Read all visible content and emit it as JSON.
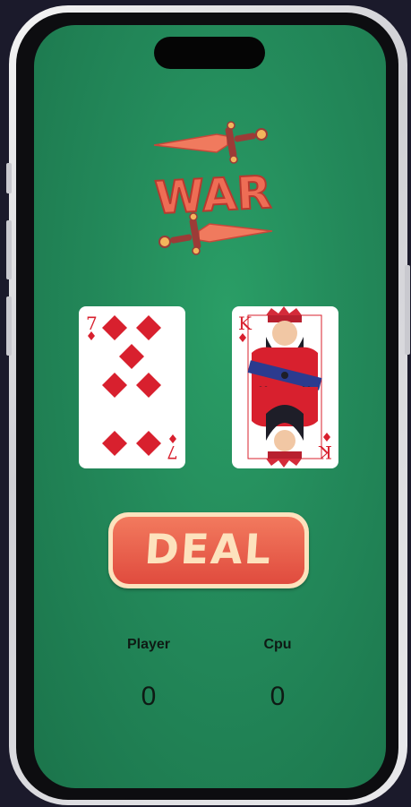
{
  "logo": {
    "text": "WAR"
  },
  "cards": {
    "player": {
      "rank": "7",
      "suit": "diamonds"
    },
    "cpu": {
      "rank": "K",
      "suit": "diamonds"
    }
  },
  "deal_button": {
    "label": "DEAL"
  },
  "scores": {
    "player_label": "Player",
    "cpu_label": "Cpu",
    "player_score": "0",
    "cpu_score": "0"
  },
  "colors": {
    "table_green": "#23895a",
    "accent_red": "#e04b3e",
    "cream": "#fde2bd",
    "suit_red": "#d8202e"
  }
}
